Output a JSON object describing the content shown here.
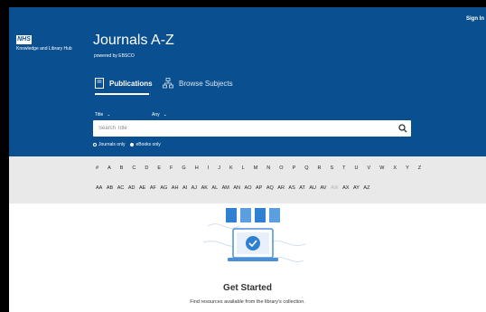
{
  "header": {
    "sign_in": "Sign In",
    "logo_text": "NHS",
    "hub_text": "Knowledge and Library Hub",
    "title": "Journals A-Z",
    "powered": "powered by EBSCO"
  },
  "tabs": [
    {
      "label": "Publications",
      "active": true
    },
    {
      "label": "Browse Subjects",
      "active": false
    }
  ],
  "filters": {
    "field": "Title",
    "match": "Any"
  },
  "search": {
    "placeholder": "Search Title",
    "value": ""
  },
  "radios": [
    {
      "label": "Journals only",
      "selected": false
    },
    {
      "label": "eBooks only",
      "selected": true
    }
  ],
  "letters_row1": [
    "#",
    "A",
    "B",
    "C",
    "D",
    "E",
    "F",
    "G",
    "H",
    "I",
    "J",
    "K",
    "L",
    "M",
    "N",
    "O",
    "P",
    "Q",
    "R",
    "S",
    "T",
    "U",
    "V",
    "W",
    "X",
    "Y",
    "Z"
  ],
  "letters_row2": [
    "AA",
    "AB",
    "AC",
    "AD",
    "AE",
    "AF",
    "AG",
    "AH",
    "AI",
    "AJ",
    "AK",
    "AL",
    "AM",
    "AN",
    "AO",
    "AP",
    "AQ",
    "AR",
    "AS",
    "AT",
    "AU",
    "AV",
    "AW",
    "AX",
    "AY",
    "AZ"
  ],
  "dim_letter": "AW",
  "main": {
    "title": "Get Started",
    "subtitle": "Find resources available from the library's collection."
  },
  "colors": {
    "header_bg": "#0a4f8f",
    "letter_bar_bg": "#e9e9e9",
    "accent": "#2f80d1"
  }
}
